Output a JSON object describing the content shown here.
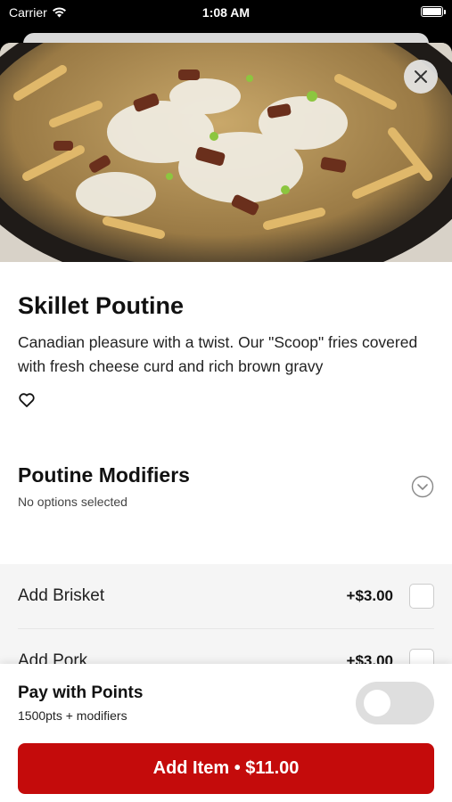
{
  "status_bar": {
    "carrier": "Carrier",
    "time": "1:08 AM"
  },
  "item": {
    "title": "Skillet Poutine",
    "description": "Canadian pleasure with a twist. Our \"Scoop\" fries covered with fresh cheese curd and rich brown gravy",
    "image": "skillet-poutine-photo",
    "favorite_icon": "heart-outline-icon"
  },
  "modifiers": {
    "title": "Poutine Modifiers",
    "subtitle": "No options selected",
    "expand_icon": "chevron-down-circle-icon",
    "options": [
      {
        "label": "Add Brisket",
        "price": "+$3.00",
        "checked": false
      },
      {
        "label": "Add Pork",
        "price": "+$3.00",
        "checked": false
      }
    ]
  },
  "points": {
    "title": "Pay with Points",
    "subtitle": "1500pts + modifiers",
    "toggle_on": false
  },
  "action": {
    "add_label": "Add Item • $11.00"
  },
  "colors": {
    "accent": "#c40b0b",
    "toggle_off": "#dedede"
  }
}
